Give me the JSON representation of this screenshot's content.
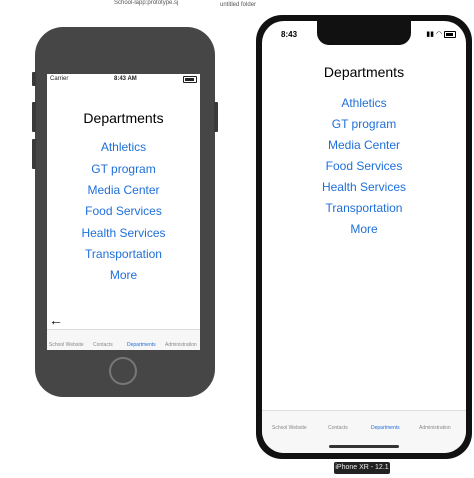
{
  "desktop": {
    "file_label": "School-lapp:prototype.sj",
    "folder_label": "untitled folder"
  },
  "phone8": {
    "status": {
      "carrier": "Carrier",
      "time": "8:43 AM"
    },
    "title": "Departments",
    "items": [
      "Athletics",
      "GT program",
      "Media Center",
      "Food Services",
      "Health Services",
      "Transportation",
      "More"
    ],
    "back_arrow": "←",
    "tabs": [
      "School Website",
      "Contacts",
      "Departments",
      "Administration"
    ],
    "active_tab": "Departments"
  },
  "phonexr": {
    "status": {
      "time": "8:43"
    },
    "title": "Departments",
    "items": [
      "Athletics",
      "GT program",
      "Media Center",
      "Food Services",
      "Health Services",
      "Transportation",
      "More"
    ],
    "tabs": [
      "School Website",
      "Contacts",
      "Departments",
      "Administration"
    ],
    "active_tab": "Departments"
  },
  "device_label": "iPhone XR - 12.1",
  "colors": {
    "link": "#1e6fd9",
    "active_tab": "#1e6fd9",
    "inactive_tab": "#888888"
  }
}
